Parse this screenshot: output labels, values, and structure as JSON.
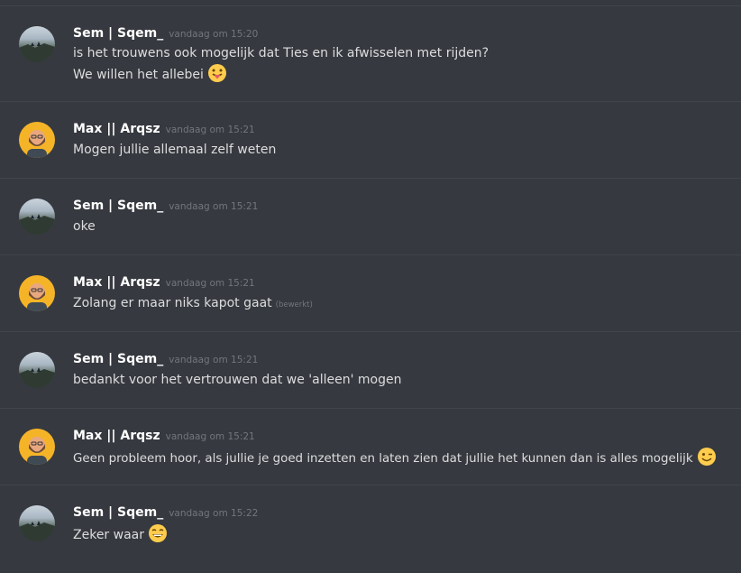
{
  "messages": [
    {
      "user": "Sem | Sqem_",
      "timestamp": "vandaag om 15:20",
      "lines": [
        "is het trouwens ook mogelijk dat Ties en ik afwisselen met rijden?",
        "We willen het allebei"
      ]
    },
    {
      "user": "Max || Arqsz",
      "timestamp": "vandaag om 15:21",
      "lines": [
        "Mogen jullie allemaal zelf weten"
      ]
    },
    {
      "user": "Sem | Sqem_",
      "timestamp": "vandaag om 15:21",
      "lines": [
        "oke"
      ]
    },
    {
      "user": "Max || Arqsz",
      "timestamp": "vandaag om 15:21",
      "lines": [
        "Zolang er maar niks kapot gaat"
      ],
      "edited": "(bewerkt)"
    },
    {
      "user": "Sem | Sqem_",
      "timestamp": "vandaag om 15:21",
      "lines": [
        "bedankt voor het vertrouwen dat we 'alleen' mogen"
      ]
    },
    {
      "user": "Max || Arqsz",
      "timestamp": "vandaag om 15:21",
      "lines": [
        "Geen probleem hoor, als jullie je goed inzetten en laten zien dat jullie het kunnen dan is alles mogelijk"
      ]
    },
    {
      "user": "Sem | Sqem_",
      "timestamp": "vandaag om 15:22",
      "lines": [
        "Zeker waar"
      ]
    }
  ],
  "emojis": [
    "tongue-out-emoji",
    "winking-emoji",
    "grinning-emoji"
  ],
  "colors": {
    "background": "#36393f",
    "username": "#ffffff",
    "text": "#dcddde",
    "timestamp": "#72767d",
    "avatar_max": "#f5b428"
  }
}
